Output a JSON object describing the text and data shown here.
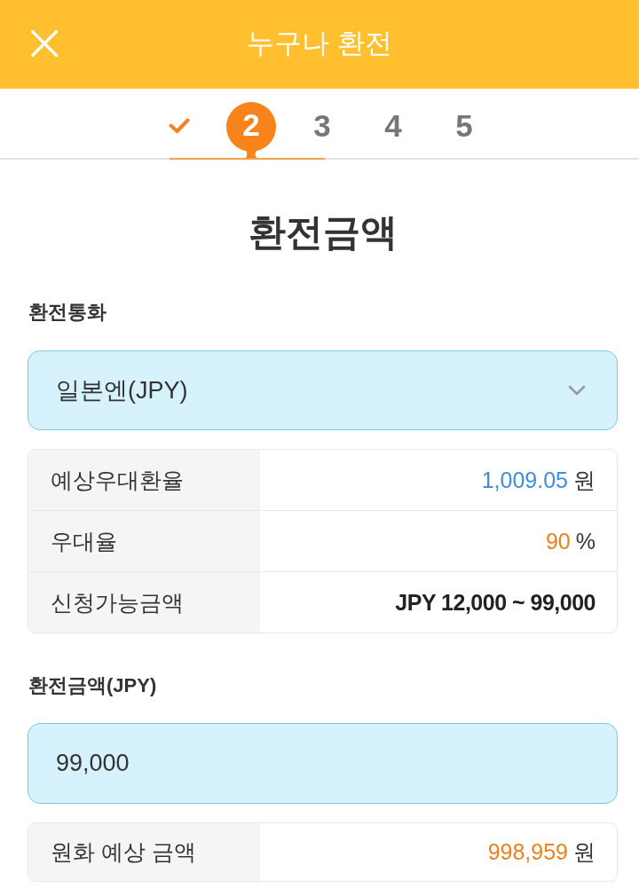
{
  "header": {
    "title": "누구나 환전"
  },
  "steps": [
    {
      "kind": "done",
      "selected": false
    },
    {
      "kind": "number",
      "label": "2",
      "selected": true
    },
    {
      "kind": "number",
      "label": "3",
      "selected": false
    },
    {
      "kind": "number",
      "label": "4",
      "selected": false
    },
    {
      "kind": "number",
      "label": "5",
      "selected": false
    }
  ],
  "page_title": "환전금액",
  "currency": {
    "label": "환전통화",
    "value": "일본엔(JPY)"
  },
  "rate_table": {
    "rows": [
      {
        "kind": "unit",
        "label": "예상우대환율",
        "value": "1,009.05",
        "unit": "원",
        "color": "#3d8ee0"
      },
      {
        "kind": "unit",
        "label": "우대율",
        "value": "90",
        "unit": "%",
        "color": "#f07f1e"
      },
      {
        "kind": "bold",
        "label": "신청가능금액",
        "value": "JPY 12,000 ~ 99,000"
      }
    ]
  },
  "amount": {
    "label": "환전금액(JPY)",
    "value": "99,000"
  },
  "estimate_table": {
    "rows": [
      {
        "kind": "unit",
        "label": "원화 예상 금액",
        "value": "998,959",
        "unit": "원",
        "color": "#f07f1e"
      }
    ]
  }
}
